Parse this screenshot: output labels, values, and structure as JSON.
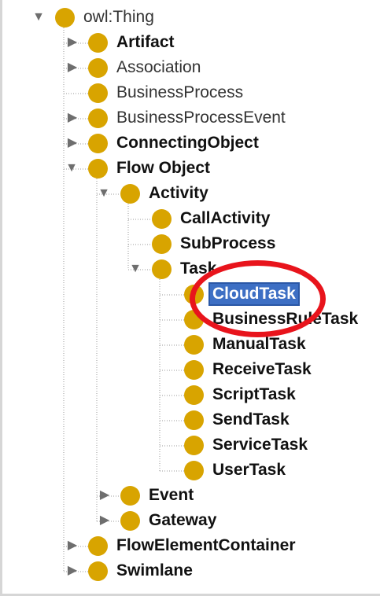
{
  "tree": {
    "nodes": [
      {
        "label": "owl:Thing",
        "toggle": "expanded"
      },
      {
        "label": "Artifact",
        "toggle": "collapsed"
      },
      {
        "label": "Association",
        "toggle": "collapsed"
      },
      {
        "label": "BusinessProcess",
        "toggle": "none"
      },
      {
        "label": "BusinessProcessEvent",
        "toggle": "collapsed"
      },
      {
        "label": "ConnectingObject",
        "toggle": "collapsed"
      },
      {
        "label": "Flow Object",
        "toggle": "expanded"
      },
      {
        "label": "Activity",
        "toggle": "expanded"
      },
      {
        "label": "CallActivity",
        "toggle": "none"
      },
      {
        "label": "SubProcess",
        "toggle": "none"
      },
      {
        "label": "Task",
        "toggle": "expanded"
      },
      {
        "label": "CloudTask",
        "toggle": "none",
        "selected": true
      },
      {
        "label": "BusinessRuleTask",
        "toggle": "none"
      },
      {
        "label": "ManualTask",
        "toggle": "none"
      },
      {
        "label": "ReceiveTask",
        "toggle": "none"
      },
      {
        "label": "ScriptTask",
        "toggle": "none"
      },
      {
        "label": "SendTask",
        "toggle": "none"
      },
      {
        "label": "ServiceTask",
        "toggle": "none"
      },
      {
        "label": "UserTask",
        "toggle": "none"
      },
      {
        "label": "Event",
        "toggle": "collapsed"
      },
      {
        "label": "Gateway",
        "toggle": "collapsed"
      },
      {
        "label": "FlowElementContainer",
        "toggle": "collapsed"
      },
      {
        "label": "Swimlane",
        "toggle": "collapsed"
      }
    ]
  },
  "icons": {
    "class_node": "class-circle-icon",
    "expanded": "triangle-down-icon",
    "collapsed": "triangle-right-icon"
  },
  "colors": {
    "class_node": "#d8a400",
    "selection": "#3d6fc4",
    "annotation_ring": "#e8141c"
  }
}
